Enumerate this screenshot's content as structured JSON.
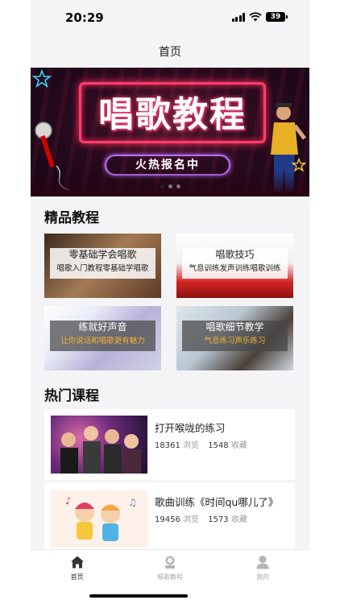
{
  "status_bar": {
    "time": "20:29",
    "battery": "39"
  },
  "nav": {
    "title": "首页"
  },
  "banner": {
    "title": "唱歌教程",
    "subtitle": "火热报名中",
    "page_count": 3,
    "active_page": 0
  },
  "featured": {
    "heading": "精品教程",
    "cards": [
      {
        "title": "零基础学会唱歌",
        "subtitle": "唱歌入门教程零基础学唱歌",
        "style": "light"
      },
      {
        "title": "唱歌技巧",
        "subtitle": "气息训练发声训练唱歌训练",
        "style": "light"
      },
      {
        "title": "练就好声音",
        "subtitle": "让你说话和唱歌更有魅力",
        "style": "dark"
      },
      {
        "title": "唱歌细节教学",
        "subtitle": "气息练习声乐练习",
        "style": "dark"
      }
    ]
  },
  "hot": {
    "heading": "热门课程",
    "courses": [
      {
        "title": "打开喉咙的练习",
        "views": "18361",
        "views_unit": "浏览",
        "favorites": "1548",
        "favorites_unit": "收藏"
      },
      {
        "title": "歌曲训练《时间qu哪儿了》",
        "views": "19456",
        "views_unit": "浏览",
        "favorites": "1573",
        "favorites_unit": "收藏"
      }
    ]
  },
  "tabbar": {
    "items": [
      {
        "label": "首页",
        "icon": "home-icon",
        "active": true
      },
      {
        "label": "唱歌教程",
        "icon": "search-icon",
        "active": false
      },
      {
        "label": "我的",
        "icon": "profile-icon",
        "active": false
      }
    ]
  },
  "colors": {
    "accent": "#ff3d6e",
    "highlight_text": "#f2b233",
    "page_bg": "#f4f4f6"
  }
}
